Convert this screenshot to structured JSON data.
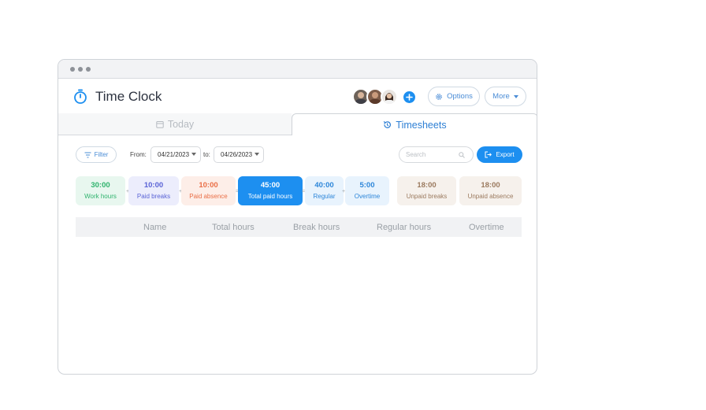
{
  "app": {
    "title": "Time Clock",
    "icon": "stopwatch-icon"
  },
  "header": {
    "options_label": "Options",
    "more_label": "More",
    "avatars": [
      "avatar-1",
      "avatar-2",
      "avatar-3"
    ]
  },
  "tabs": [
    {
      "label": "Today",
      "icon": "calendar-icon",
      "active": false
    },
    {
      "label": "Timesheets",
      "icon": "history-icon",
      "active": true
    }
  ],
  "toolbar": {
    "filter_label": "Filter",
    "from_label": "From:",
    "from_value": "04/21/2023",
    "to_label": "to:",
    "to_value": "04/26/2023",
    "search_placeholder": "Search",
    "export_label": "Export"
  },
  "stats": [
    {
      "value": "30:00",
      "label": "Work hours",
      "bg": "#e8f7ef",
      "color": "#2fb36d"
    },
    {
      "value": "10:00",
      "label": "Paid breaks",
      "bg": "#ecedfc",
      "color": "#5a63d6"
    },
    {
      "value": "10:00",
      "label": "Paid absence",
      "bg": "#fdeee8",
      "color": "#ea6f47"
    },
    {
      "value": "45:00",
      "label": "Total paid hours",
      "bg": "#1d8ff0",
      "color": "#ffffff"
    },
    {
      "value": "40:00",
      "label": "Regular",
      "bg": "#e8f3fd",
      "color": "#2d86d9"
    },
    {
      "value": "5:00",
      "label": "Overtime",
      "bg": "#e8f3fd",
      "color": "#2d86d9"
    },
    {
      "value": "18:00",
      "label": "Unpaid breaks",
      "bg": "#f6f1ec",
      "color": "#9b7a5f"
    },
    {
      "value": "18:00",
      "label": "Unpaid absence",
      "bg": "#f6f1ec",
      "color": "#9b7a5f"
    }
  ],
  "separators": [
    "+",
    "+",
    "=",
    "=",
    "+"
  ],
  "table": {
    "columns": [
      "Name",
      "Total hours",
      "Break hours",
      "Regular hours",
      "Overtime"
    ]
  }
}
